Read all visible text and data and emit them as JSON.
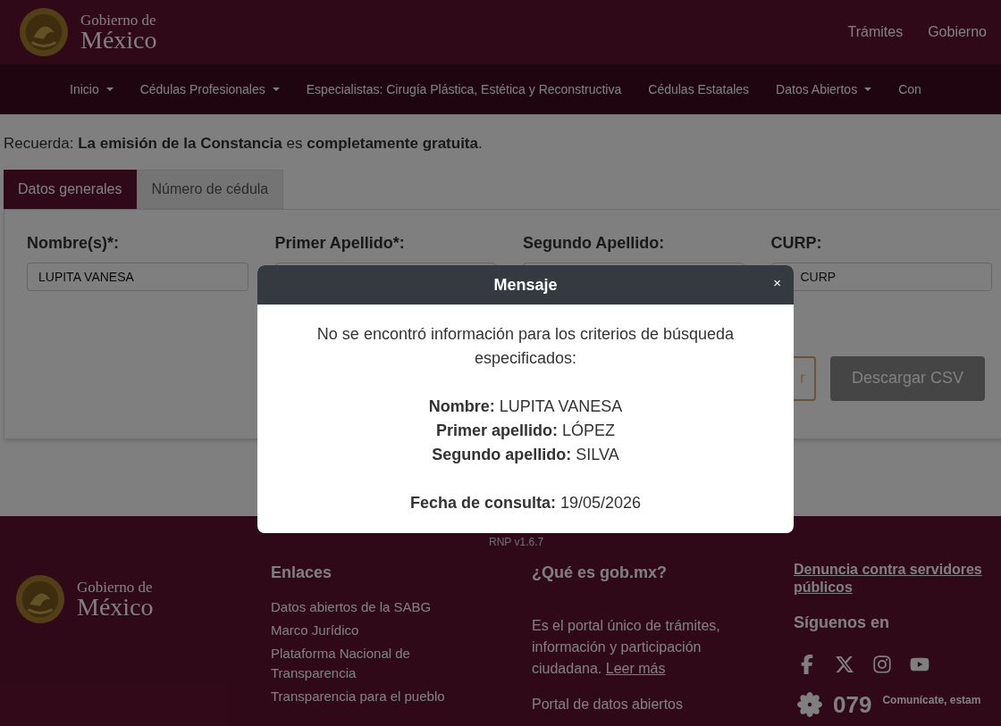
{
  "header": {
    "logo_top": "Gobierno de",
    "logo_bottom": "México",
    "links": [
      "Trámites",
      "Gobierno"
    ]
  },
  "nav": [
    {
      "label": "Inicio",
      "dropdown": true
    },
    {
      "label": "Cédulas Profesionales",
      "dropdown": true
    },
    {
      "label": "Especialistas: Cirugía Plástica, Estética y Reconstructiva",
      "dropdown": false
    },
    {
      "label": "Cédulas Estatales",
      "dropdown": false
    },
    {
      "label": "Datos Abiertos",
      "dropdown": true
    },
    {
      "label": "Con",
      "dropdown": false
    }
  ],
  "notice": "Recuerda: **La emisión de la Constancia** es **completamente gratuita**.",
  "tabs": [
    {
      "label": "Datos generales",
      "selected": true
    },
    {
      "label": "Número de cédula",
      "selected": false
    }
  ],
  "form": {
    "fields": [
      {
        "label": "Nombre(s)*:",
        "value": "LUPITA VANESA"
      },
      {
        "label": "Primer Apellido*:"
      },
      {
        "label": "Segundo Apellido:"
      },
      {
        "label": "CURP:",
        "placeholder": "CURP"
      }
    ],
    "buttons": [
      {
        "label": "r",
        "kind": "outline"
      },
      {
        "label": "Descargar CSV",
        "kind": "disabled"
      }
    ]
  },
  "modal": {
    "title": "Mensaje",
    "close": "×",
    "message": "No se encontró información para los criterios de búsqueda especificados:",
    "details": [
      {
        "label": "Nombre:",
        "value": "LUPITA VANESA"
      },
      {
        "label": "Primer apellido:",
        "value": "LÓPEZ"
      },
      {
        "label": "Segundo apellido:",
        "value": "SILVA"
      }
    ],
    "date": {
      "label": "Fecha de consulta:",
      "value": "19/05/2026"
    }
  },
  "footer": {
    "version": "RNP v1.6.7",
    "logo_top": "Gobierno de",
    "logo_bottom": "México",
    "links_title": "Enlaces",
    "links": [
      "Datos abiertos de la SABG",
      "Marco Jurídico",
      "Plataforma Nacional de Transparencia",
      "Transparencia para el pueblo"
    ],
    "about_title": "¿Qué es gob.mx?",
    "about_text": "Es el portal único de trámites, información y participación ciudadana.",
    "about_link": "Leer más",
    "about_extra": "Portal de datos abiertos",
    "denuncia": "Denuncia contra servidores públicos",
    "follow": "Síguenos en",
    "phone": "079",
    "phone_text": "Comunícate, estam"
  }
}
